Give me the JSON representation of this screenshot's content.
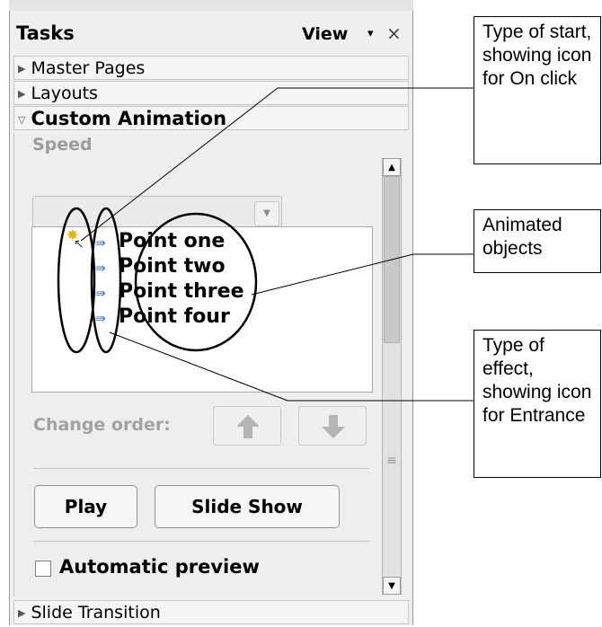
{
  "panel": {
    "title": "Tasks",
    "view_label": "View",
    "view_dropdown_glyph": "▾",
    "close_glyph": "×"
  },
  "sections": {
    "master_pages": "Master Pages",
    "layouts": "Layouts",
    "custom_animation": "Custom Animation",
    "slide_transition": "Slide Transition"
  },
  "custom_animation": {
    "speed_label": "Speed",
    "speed_value": "",
    "items": [
      {
        "label": "Point one",
        "effect_icon": "entrance-icon"
      },
      {
        "label": "Point two",
        "effect_icon": "entrance-icon"
      },
      {
        "label": "Point three",
        "effect_icon": "entrance-icon"
      },
      {
        "label": "Point four",
        "effect_icon": "entrance-icon"
      }
    ],
    "first_item_start_icon": "on-click-icon",
    "change_order_label": "Change order:",
    "play_label": "Play",
    "slideshow_label": "Slide Show",
    "automatic_preview_label": "Automatic preview",
    "automatic_preview_checked": false
  },
  "callouts": {
    "type_of_start": "Type of start, showing icon for On click",
    "animated_objects": "Animated objects",
    "type_of_effect": "Type of effect, showing icon for Entrance"
  }
}
